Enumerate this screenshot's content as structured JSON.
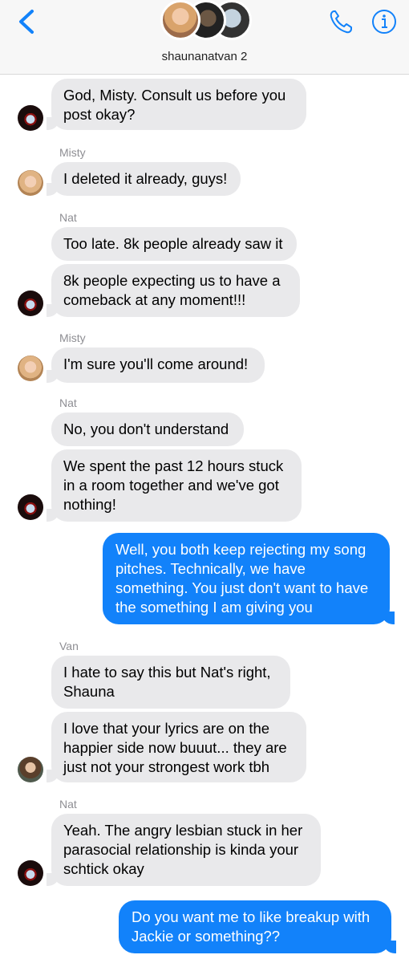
{
  "conversation": {
    "title": "shaunanatvan 2",
    "accent_color": "#1282fa",
    "incoming_bubble_color": "#e9e9eb",
    "icons": {
      "back": "chevron-left-icon",
      "call": "phone-icon",
      "details": "info-icon"
    }
  },
  "messages": [
    {
      "sender": "",
      "text": "God, Misty. Consult us before you post okay?"
    },
    {
      "sender": "Misty",
      "text": "I deleted it already, guys!"
    },
    {
      "sender": "Nat",
      "text": "Too late. 8k people already saw it"
    },
    {
      "sender": "",
      "text": "8k people expecting us to have a comeback at any moment!!!"
    },
    {
      "sender": "Misty",
      "text": "I'm sure you'll come around!"
    },
    {
      "sender": "Nat",
      "text": "No, you don't understand"
    },
    {
      "sender": "",
      "text": "We spent the past 12 hours stuck in a room together and we've got nothing!"
    },
    {
      "sender": "",
      "text": "Well, you both keep rejecting my song pitches. Technically, we have something. You just don't want to have the something I am giving you"
    },
    {
      "sender": "Van",
      "text": "I hate to say this but Nat's right, Shauna"
    },
    {
      "sender": "",
      "text": "I love that your lyrics are on the happier side now buuut... they are just not your strongest work tbh"
    },
    {
      "sender": "Nat",
      "text": "Yeah. The angry lesbian stuck in her parasocial relationship is kinda your schtick okay"
    },
    {
      "sender": "",
      "text": "Do you want me to like breakup with Jackie or something??"
    }
  ]
}
